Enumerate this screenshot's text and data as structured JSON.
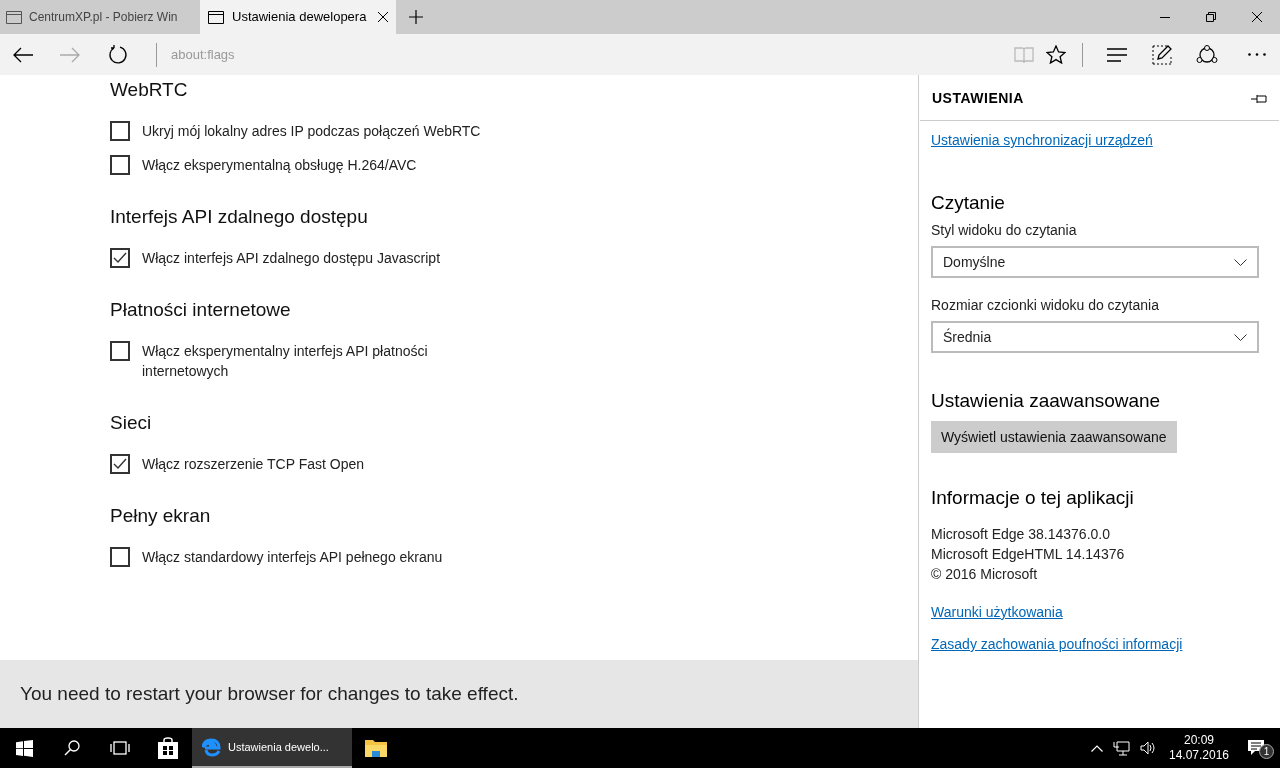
{
  "tabs": [
    {
      "title": "CentrumXP.pl - Pobierz Win",
      "selected": false
    },
    {
      "title": "Ustawienia dewelopera",
      "selected": true
    }
  ],
  "address": "about:flags",
  "sections": [
    {
      "heading": "WebRTC",
      "options": [
        {
          "label": "Ukryj mój lokalny adres IP podczas połączeń WebRTC",
          "checked": false
        },
        {
          "label": "Włącz eksperymentalną obsługę H.264/AVC",
          "checked": false
        }
      ]
    },
    {
      "heading": "Interfejs API zdalnego dostępu",
      "options": [
        {
          "label": "Włącz interfejs API zdalnego dostępu Javascript",
          "checked": true
        }
      ]
    },
    {
      "heading": "Płatności internetowe",
      "options": [
        {
          "label": "Włącz eksperymentalny interfejs API płatności internetowych",
          "checked": false
        }
      ]
    },
    {
      "heading": "Sieci",
      "options": [
        {
          "label": "Włącz rozszerzenie TCP Fast Open",
          "checked": true
        }
      ]
    },
    {
      "heading": "Pełny ekran",
      "options": [
        {
          "label": "Włącz standardowy interfejs API pełnego ekranu",
          "checked": false
        }
      ]
    }
  ],
  "notice": "You need to restart your browser for changes to take effect.",
  "settings_panel": {
    "title": "USTAWIENIA",
    "sync_link": "Ustawienia synchronizacji urządzeń",
    "reading": {
      "heading": "Czytanie",
      "fields": [
        {
          "label": "Styl widoku do czytania",
          "value": "Domyślne"
        },
        {
          "label": "Rozmiar czcionki widoku do czytania",
          "value": "Średnia"
        }
      ]
    },
    "advanced": {
      "heading": "Ustawienia zaawansowane",
      "button": "Wyświetl ustawienia zaawansowane"
    },
    "about": {
      "heading": "Informacje o tej aplikacji",
      "lines": [
        "Microsoft Edge 38.14376.0.0",
        "Microsoft EdgeHTML 14.14376",
        "© 2016 Microsoft"
      ],
      "links": [
        "Warunki użytkowania",
        "Zasady zachowania poufności informacji"
      ]
    }
  },
  "taskbar": {
    "active_app": "Ustawienia dewelo...",
    "time": "20:09",
    "date": "14.07.2016",
    "notification_count": "1"
  }
}
